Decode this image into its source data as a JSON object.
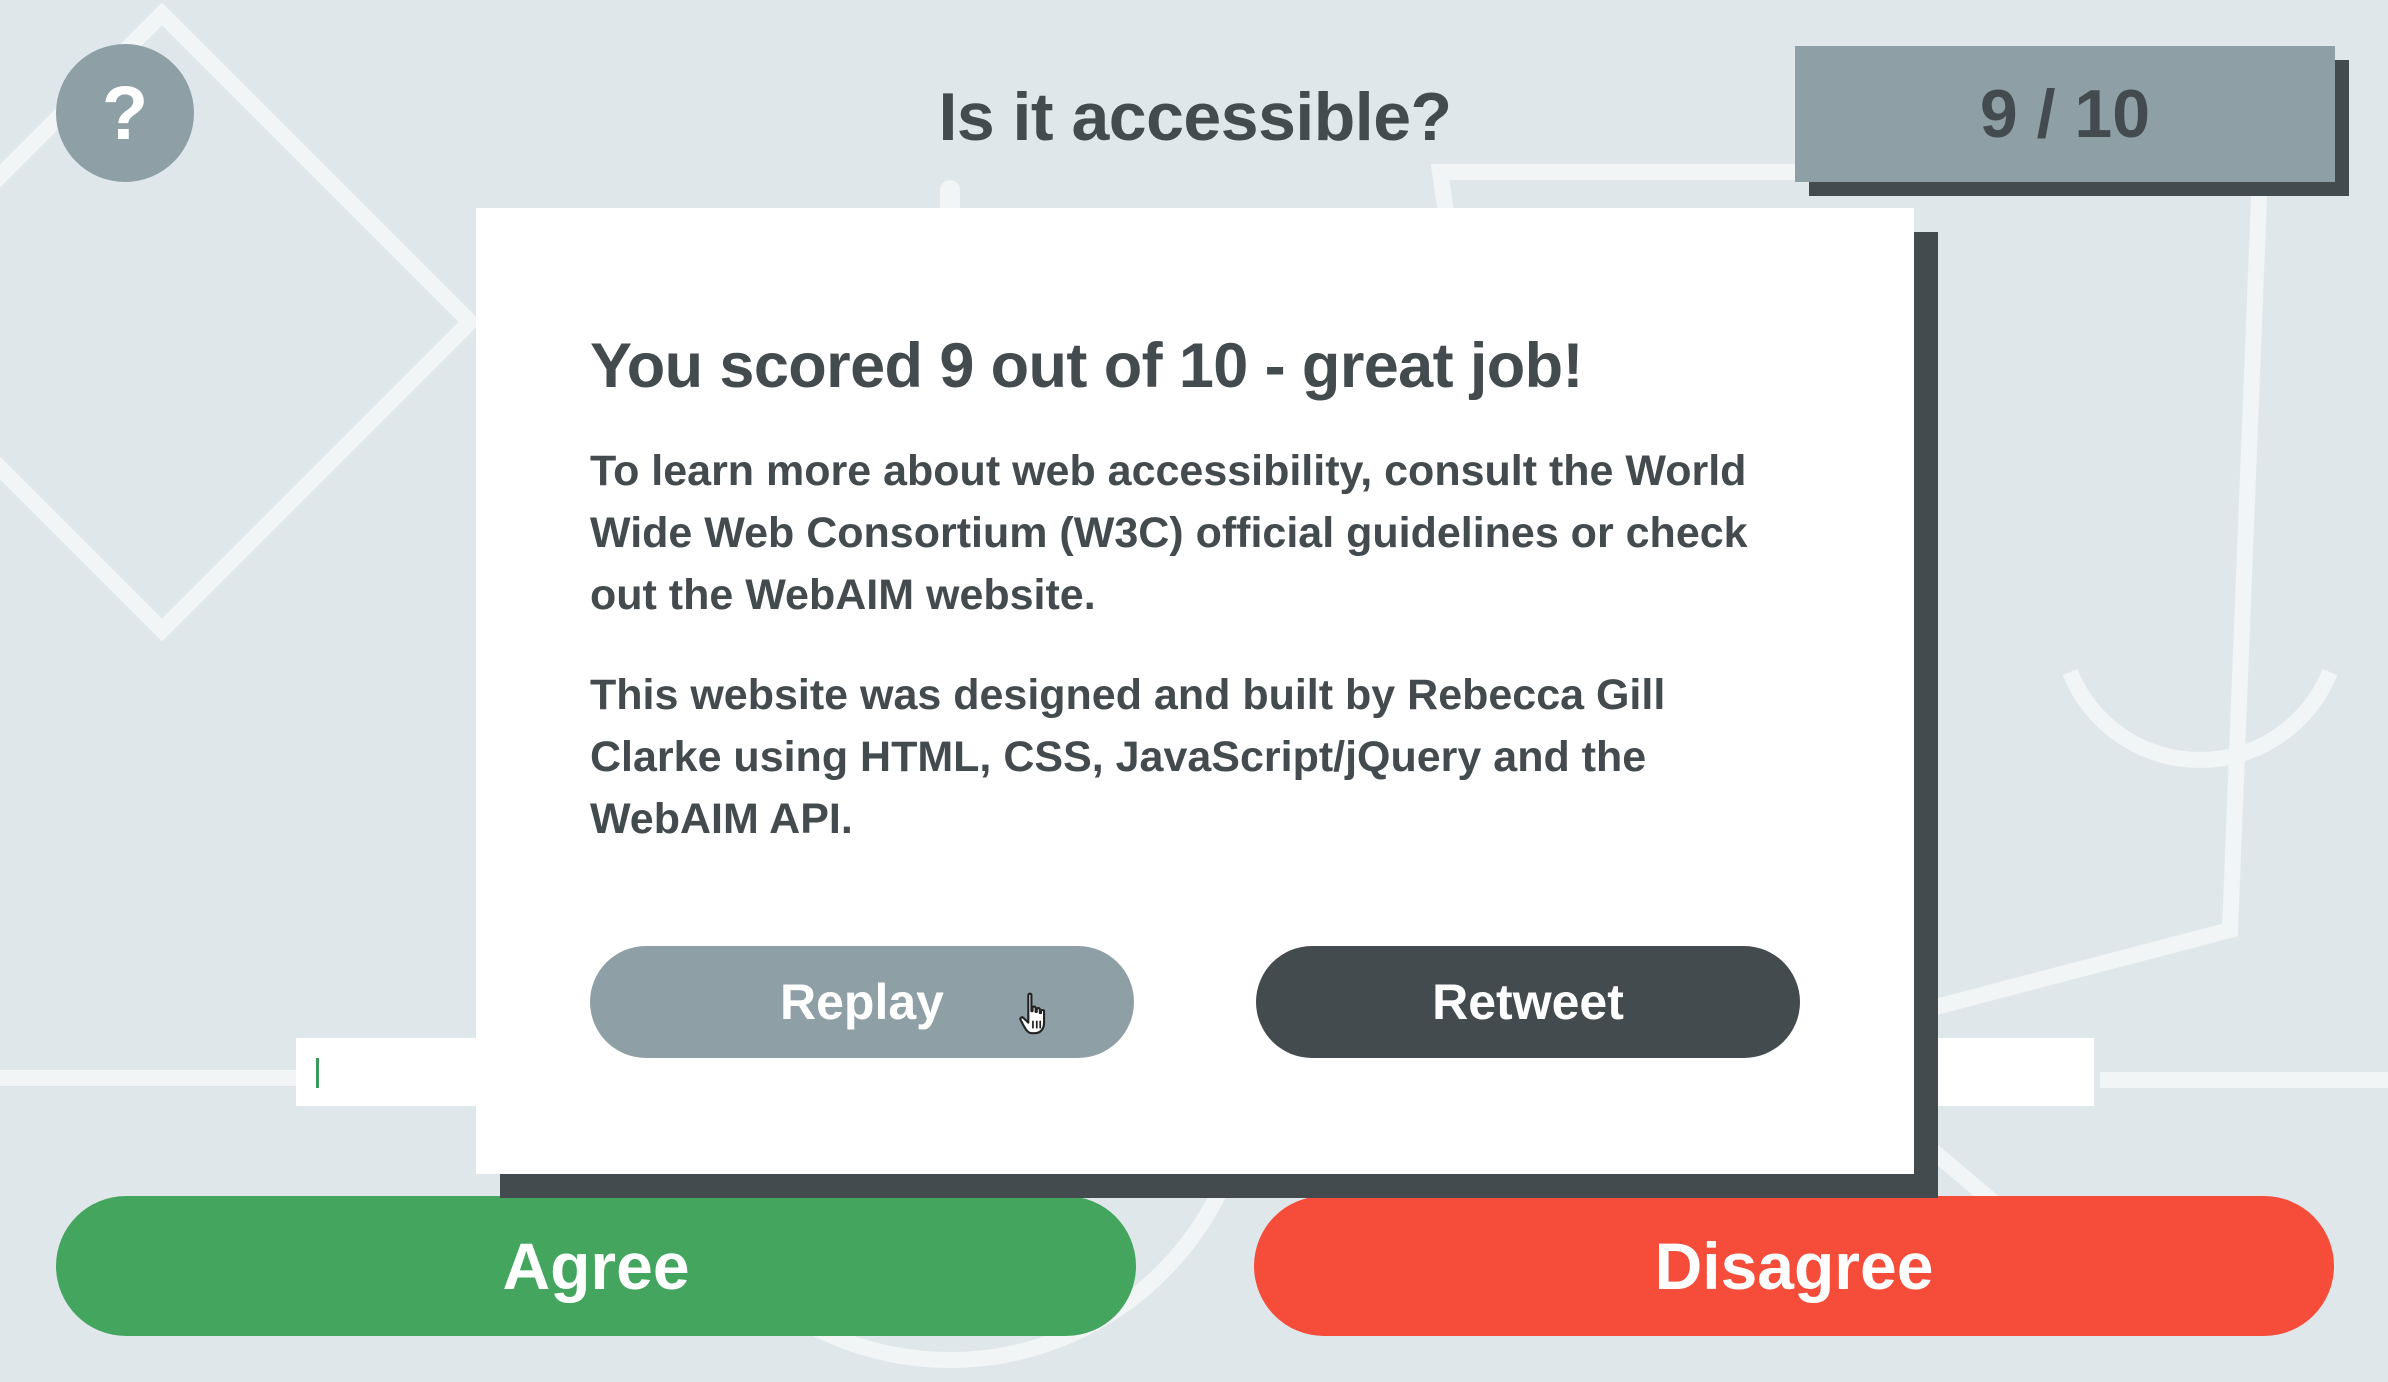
{
  "header": {
    "help_label": "?",
    "title": "Is it accessible?",
    "score": "9 / 10"
  },
  "modal": {
    "heading": "You scored 9 out of 10 - great job!",
    "paragraph_1": "To learn more about web accessibility, consult the World Wide Web Consortium (W3C) official guidelines or check out the WebAIM website.",
    "paragraph_2": "This website was designed and built by Rebecca Gill Clarke using HTML, CSS, JavaScript/jQuery and the WebAIM API.",
    "replay_label": "Replay",
    "retweet_label": "Retweet"
  },
  "answers": {
    "agree_label": "Agree",
    "disagree_label": "Disagree"
  },
  "icons": {
    "help": "question-mark-icon",
    "cursor": "hand-pointer-icon"
  },
  "colors": {
    "background": "#dfe7ea",
    "dark": "#434b4f",
    "grey": "#8e9fa6",
    "agree": "#44a55e",
    "disagree": "#f64c3a",
    "white": "#ffffff"
  }
}
